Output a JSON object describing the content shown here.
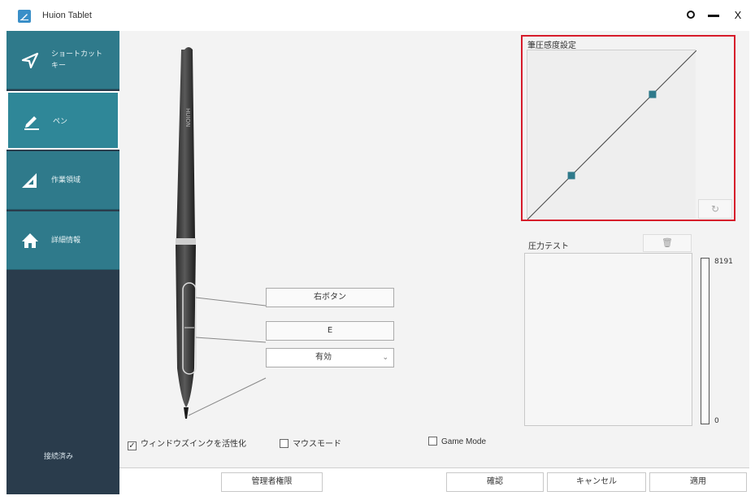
{
  "window": {
    "title": "Huion Tablet"
  },
  "sidebar": {
    "items": [
      {
        "label": "ショートカット\nキー",
        "icon": "send-icon"
      },
      {
        "label": "ペン",
        "icon": "pen-icon"
      },
      {
        "label": "作業領域",
        "icon": "triangle-ruler-icon"
      },
      {
        "label": "詳細情報",
        "icon": "home-icon"
      }
    ],
    "status": "接続済み"
  },
  "pen": {
    "upper_button": "右ボタン",
    "lower_button": "E",
    "tip_select": "有効"
  },
  "checkboxes": {
    "windows_ink": {
      "label": "ウィンドウズインクを活性化",
      "checked": true
    },
    "mouse_mode": {
      "label": "マウスモード",
      "checked": false
    },
    "game_mode": {
      "label": "Game Mode",
      "checked": false
    }
  },
  "curve": {
    "title": "筆圧感度設定",
    "reset_icon": "refresh-icon",
    "control_points": [
      {
        "input": 0.26,
        "output": 0.26
      },
      {
        "input": 0.74,
        "output": 0.74
      }
    ]
  },
  "pressure_test": {
    "label": "圧力テスト",
    "clear_icon": "trash-icon",
    "max_value": "8191",
    "min_value": "0",
    "level": 0
  },
  "footer": {
    "admin": "管理者権限",
    "confirm": "確認",
    "cancel": "キャンセル",
    "apply": "適用"
  },
  "colors": {
    "sidebar_bg": "#2a3c4c",
    "nav_item": "#2f7a8b",
    "highlight_border": "#d61b2a",
    "curve_point": "#2f7a8b"
  }
}
